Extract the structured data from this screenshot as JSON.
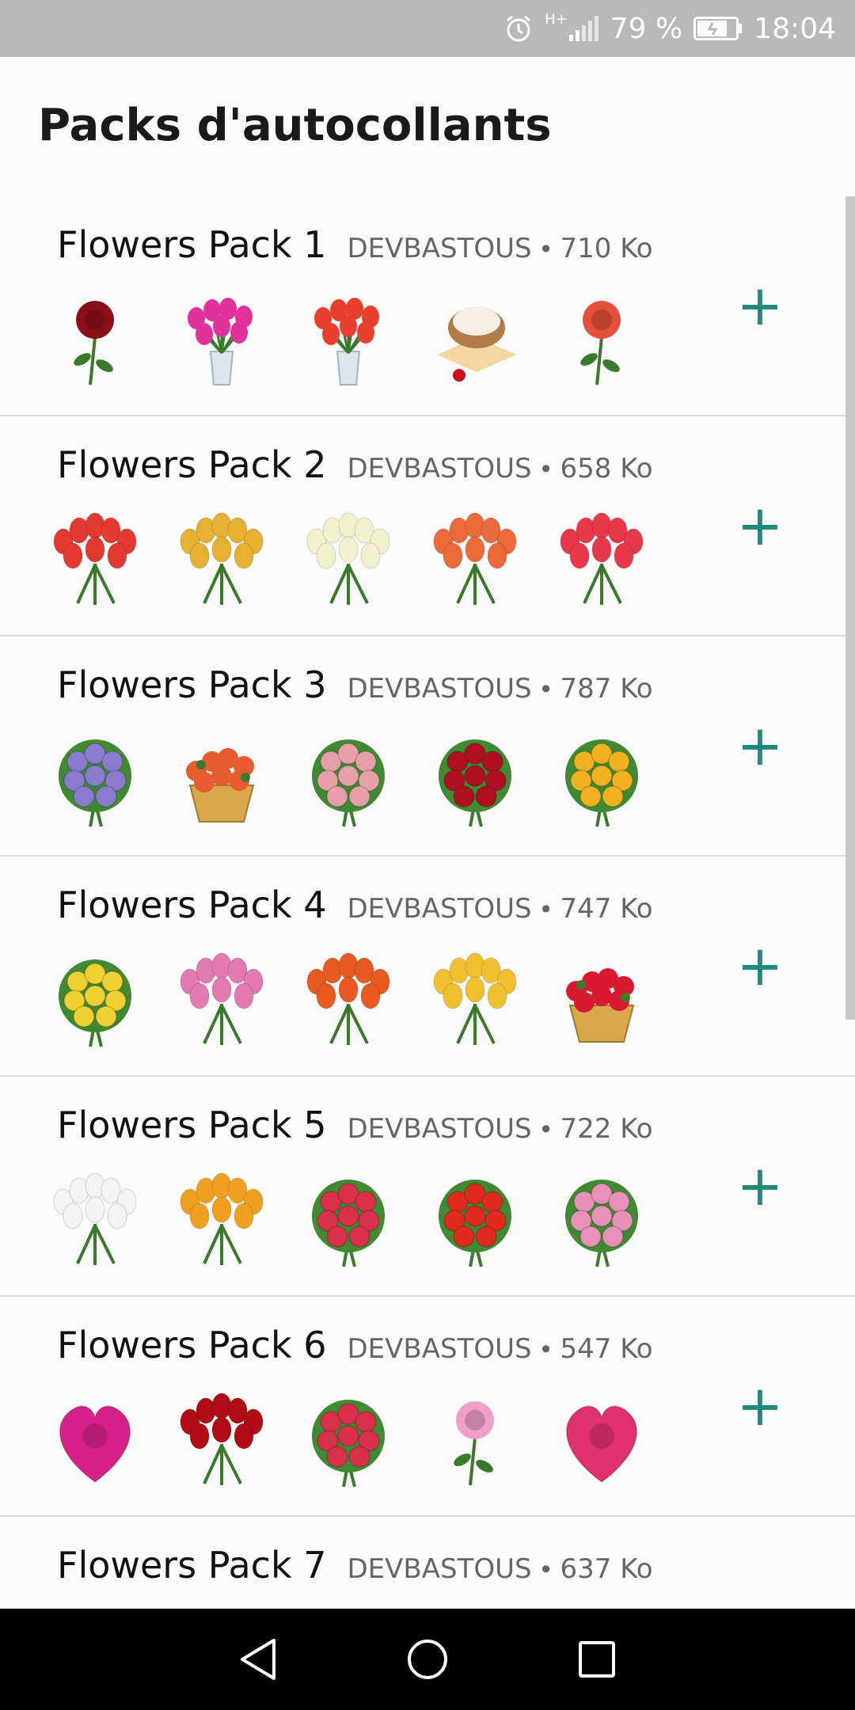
{
  "status_bar": {
    "network": "H+",
    "battery_text": "79 %",
    "battery_level": 0.79,
    "time": "18:04",
    "icons": [
      "alarm-icon",
      "signal-icon",
      "battery-icon"
    ]
  },
  "app_bar": {
    "title": "Packs d'autocollants"
  },
  "colors": {
    "accent": "#1e8a7a",
    "status_bar": "#b9b9b9",
    "nav_bar": "#000000"
  },
  "packs": [
    {
      "name": "Flowers Pack 1",
      "publisher": "DEVBASTOUS",
      "separator": "•",
      "size": "710 Ko",
      "add_icon": "+"
    },
    {
      "name": "Flowers Pack 2",
      "publisher": "DEVBASTOUS",
      "separator": "•",
      "size": "658 Ko",
      "add_icon": "+"
    },
    {
      "name": "Flowers Pack 3",
      "publisher": "DEVBASTOUS",
      "separator": "•",
      "size": "787 Ko",
      "add_icon": "+"
    },
    {
      "name": "Flowers Pack 4",
      "publisher": "DEVBASTOUS",
      "separator": "•",
      "size": "747 Ko",
      "add_icon": "+"
    },
    {
      "name": "Flowers Pack 5",
      "publisher": "DEVBASTOUS",
      "separator": "•",
      "size": "722 Ko",
      "add_icon": "+"
    },
    {
      "name": "Flowers Pack 6",
      "publisher": "DEVBASTOUS",
      "separator": "•",
      "size": "547 Ko",
      "add_icon": "+"
    },
    {
      "name": "Flowers Pack 7",
      "publisher": "DEVBASTOUS",
      "separator": "•",
      "size": "637 Ko",
      "add_icon": "+"
    }
  ],
  "nav_bar": {
    "icons": [
      "back-icon",
      "home-icon",
      "recents-icon"
    ]
  }
}
